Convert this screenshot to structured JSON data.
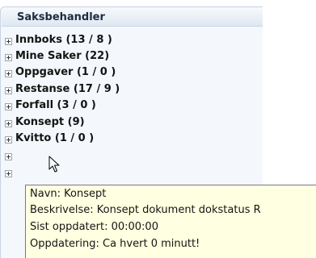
{
  "panel": {
    "title": "Saksbehandler",
    "items": [
      {
        "label": "Innboks (13 / 8 )"
      },
      {
        "label": "Mine Saker (22)"
      },
      {
        "label": "Oppgaver (1 / 0 )"
      },
      {
        "label": "Restanse (17 / 9 )"
      },
      {
        "label": "Forfall (3 / 0 )"
      },
      {
        "label": "Konsept (9)"
      },
      {
        "label": "Kvitto (1 / 0 )"
      }
    ]
  },
  "tooltip": {
    "name": "Navn: Konsept",
    "description": "Beskrivelse:  Konsept dokument dokstatus R",
    "last_updated": "Sist oppdatert:  00:00:00",
    "update": "Oppdatering: Ca hvert 0 minutt!"
  },
  "icons": {
    "expander": "plus-expander-icon",
    "cursor": "mouse-pointer-icon"
  }
}
